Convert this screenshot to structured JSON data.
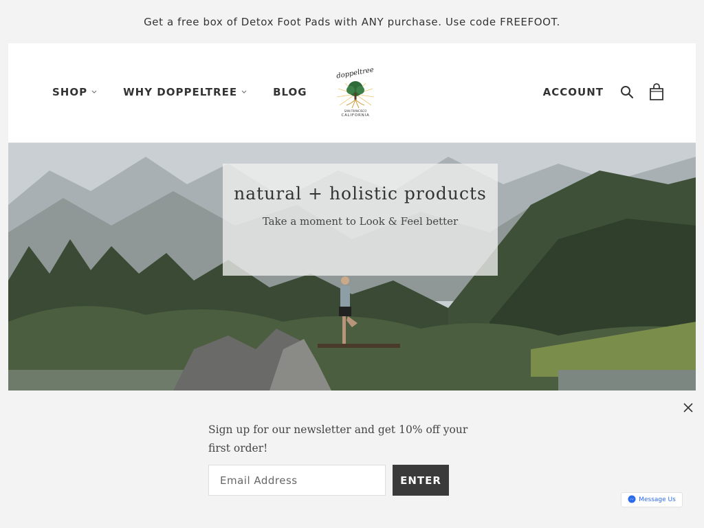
{
  "announcement": "Get a free box of Detox Foot Pads with ANY purchase. Use code FREEFOOT.",
  "nav": {
    "left": [
      {
        "label": "SHOP",
        "has_dropdown": true
      },
      {
        "label": "WHY DOPPELTREE",
        "has_dropdown": true
      },
      {
        "label": "BLOG",
        "has_dropdown": false
      }
    ],
    "account": "ACCOUNT",
    "icons": [
      "search-icon",
      "cart-icon",
      "chevron-down-icon"
    ]
  },
  "logo": {
    "brand": "doppeltree",
    "location": "SAN FRANCISCO CALIFORNIA"
  },
  "hero": {
    "title": "natural + holistic products",
    "subtitle": "Take a moment to Look & Feel better"
  },
  "newsletter": {
    "text": "Sign up for our newsletter and get 10% off your first order!",
    "email_placeholder": "Email Address",
    "button": "ENTER"
  },
  "messenger": {
    "label": "Message Us"
  },
  "colors": {
    "button_dark": "#3a3a3a",
    "messenger_blue": "#2d6be8",
    "background": "#f3f3f3"
  }
}
